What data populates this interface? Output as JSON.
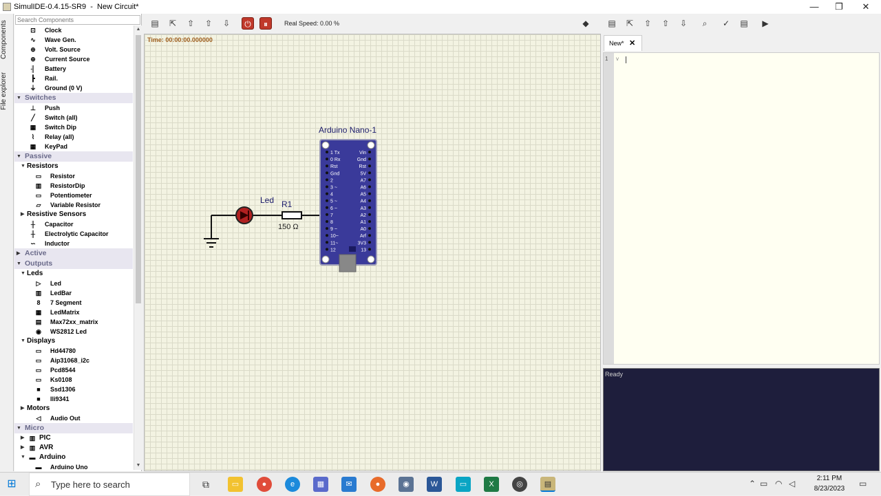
{
  "window": {
    "title": "SimulIDE-0.4.15-SR9  -  New Circuit*",
    "min": "—",
    "max": "❐",
    "close": "✕"
  },
  "side_tabs": {
    "components": "Components",
    "file_explorer": "File explorer"
  },
  "search": {
    "placeholder": "Search Components"
  },
  "tree": [
    {
      "kind": "item",
      "label": "Clock",
      "indent": 2,
      "icon": "clock-icon",
      "glyph": "⊡"
    },
    {
      "kind": "item",
      "label": "Wave Gen.",
      "indent": 2,
      "icon": "wave-icon",
      "glyph": "∿"
    },
    {
      "kind": "item",
      "label": "Volt. Source",
      "indent": 2,
      "icon": "volt-source-icon",
      "glyph": "⊕"
    },
    {
      "kind": "item",
      "label": "Current Source",
      "indent": 2,
      "icon": "current-source-icon",
      "glyph": "⊕"
    },
    {
      "kind": "item",
      "label": "Battery",
      "indent": 2,
      "icon": "battery-icon",
      "glyph": "╢"
    },
    {
      "kind": "item",
      "label": "Rail.",
      "indent": 2,
      "icon": "rail-icon",
      "glyph": "┣"
    },
    {
      "kind": "item",
      "label": "Ground (0 V)",
      "indent": 2,
      "icon": "ground-icon",
      "glyph": "⏚"
    },
    {
      "kind": "cat",
      "label": "Switches"
    },
    {
      "kind": "item",
      "label": "Push",
      "indent": 2,
      "icon": "push-icon",
      "glyph": "⊥"
    },
    {
      "kind": "item",
      "label": "Switch (all)",
      "indent": 2,
      "icon": "switch-icon",
      "glyph": "╱"
    },
    {
      "kind": "item",
      "label": "Switch Dip",
      "indent": 2,
      "icon": "switch-dip-icon",
      "glyph": "▦"
    },
    {
      "kind": "item",
      "label": "Relay (all)",
      "indent": 2,
      "icon": "relay-icon",
      "glyph": "⌇"
    },
    {
      "kind": "item",
      "label": "KeyPad",
      "indent": 2,
      "icon": "keypad-icon",
      "glyph": "▦"
    },
    {
      "kind": "cat",
      "label": "Passive"
    },
    {
      "kind": "sub",
      "label": "Resistors"
    },
    {
      "kind": "item",
      "label": "Resistor",
      "indent": 3,
      "icon": "resistor-icon",
      "glyph": "▭"
    },
    {
      "kind": "item",
      "label": "ResistorDip",
      "indent": 3,
      "icon": "resistor-dip-icon",
      "glyph": "▥"
    },
    {
      "kind": "item",
      "label": "Potentiometer",
      "indent": 3,
      "icon": "potentiometer-icon",
      "glyph": "▭"
    },
    {
      "kind": "item",
      "label": "Variable Resistor",
      "indent": 3,
      "icon": "variable-resistor-icon",
      "glyph": "▱"
    },
    {
      "kind": "sub",
      "label": "Resistive Sensors",
      "collapsed": true
    },
    {
      "kind": "item",
      "label": "Capacitor",
      "indent": 2,
      "icon": "capacitor-icon",
      "glyph": "╫"
    },
    {
      "kind": "item",
      "label": "Electrolytic Capacitor",
      "indent": 2,
      "icon": "electrolytic-capacitor-icon",
      "glyph": "╫"
    },
    {
      "kind": "item",
      "label": "Inductor",
      "indent": 2,
      "icon": "inductor-icon",
      "glyph": "∽"
    },
    {
      "kind": "cat",
      "label": "Active",
      "collapsed": true
    },
    {
      "kind": "cat",
      "label": "Outputs"
    },
    {
      "kind": "sub",
      "label": "Leds"
    },
    {
      "kind": "item",
      "label": "Led",
      "indent": 3,
      "icon": "led-icon",
      "glyph": "▷"
    },
    {
      "kind": "item",
      "label": "LedBar",
      "indent": 3,
      "icon": "ledbar-icon",
      "glyph": "▥"
    },
    {
      "kind": "item",
      "label": "7 Segment",
      "indent": 3,
      "icon": "seven-segment-icon",
      "glyph": "8"
    },
    {
      "kind": "item",
      "label": "LedMatrix",
      "indent": 3,
      "icon": "ledmatrix-icon",
      "glyph": "▦"
    },
    {
      "kind": "item",
      "label": "Max72xx_matrix",
      "indent": 3,
      "icon": "max72xx-icon",
      "glyph": "▤"
    },
    {
      "kind": "item",
      "label": "WS2812 Led",
      "indent": 3,
      "icon": "ws2812-icon",
      "glyph": "◉"
    },
    {
      "kind": "sub",
      "label": "Displays"
    },
    {
      "kind": "item",
      "label": "Hd44780",
      "indent": 3,
      "icon": "hd44780-icon",
      "glyph": "▭"
    },
    {
      "kind": "item",
      "label": "Aip31068_i2c",
      "indent": 3,
      "icon": "aip31068-icon",
      "glyph": "▭"
    },
    {
      "kind": "item",
      "label": "Pcd8544",
      "indent": 3,
      "icon": "pcd8544-icon",
      "glyph": "▭"
    },
    {
      "kind": "item",
      "label": "Ks0108",
      "indent": 3,
      "icon": "ks0108-icon",
      "glyph": "▭"
    },
    {
      "kind": "item",
      "label": "Ssd1306",
      "indent": 3,
      "icon": "ssd1306-icon",
      "glyph": "■"
    },
    {
      "kind": "item",
      "label": "Ili9341",
      "indent": 3,
      "icon": "ili9341-icon",
      "glyph": "■"
    },
    {
      "kind": "sub",
      "label": "Motors",
      "collapsed": true
    },
    {
      "kind": "item",
      "label": "Audio Out",
      "indent": 3,
      "icon": "speaker-icon",
      "glyph": "◁"
    },
    {
      "kind": "cat",
      "label": "Micro"
    },
    {
      "kind": "sub",
      "label": "PIC",
      "collapsed": true,
      "icon": "chip-icon",
      "glyph": "▥"
    },
    {
      "kind": "sub",
      "label": "AVR",
      "collapsed": true,
      "icon": "chip-icon",
      "glyph": "▥"
    },
    {
      "kind": "sub",
      "label": "Arduino",
      "icon": "arduino-icon",
      "glyph": "▬"
    },
    {
      "kind": "item",
      "label": "Arduino Uno",
      "indent": 3,
      "icon": "arduino-uno-icon",
      "glyph": "▬"
    }
  ],
  "toolbar": {
    "speed": "Real Speed: 0.00 %"
  },
  "canvas": {
    "time": "Time: 00:00:00.000000"
  },
  "circuit": {
    "board_title": "Arduino Nano-1",
    "led_label": "Led",
    "resistor_label": "R1",
    "resistor_value": "150 Ω",
    "left_pins": [
      "1 Tx",
      "0 Rx",
      "Rst",
      "Gnd",
      "2",
      "3 ~",
      "4",
      "5 ~",
      "6 ~",
      "7",
      "8",
      "9 ~",
      "10~",
      "11~",
      "12"
    ],
    "right_pins": [
      "Vin",
      "Gnd",
      "Rst",
      "5V",
      "A7",
      "A6",
      "A5",
      "A4",
      "A3",
      "A2",
      "A1",
      "A0",
      "Arf",
      "3V3",
      "13"
    ]
  },
  "editor": {
    "tab": "New*",
    "tab_close": "✕",
    "line_number": "1",
    "fold_marker": "v"
  },
  "output": {
    "status": "Ready"
  },
  "taskbar": {
    "search_placeholder": "Type here to search",
    "time": "2:11 PM",
    "date": "8/23/2023"
  },
  "colors": {
    "canvas_bg": "#f3f3e2",
    "board": "#3a3a9a",
    "output_bg": "#1e1e3c",
    "stop_red": "#c0392b"
  }
}
